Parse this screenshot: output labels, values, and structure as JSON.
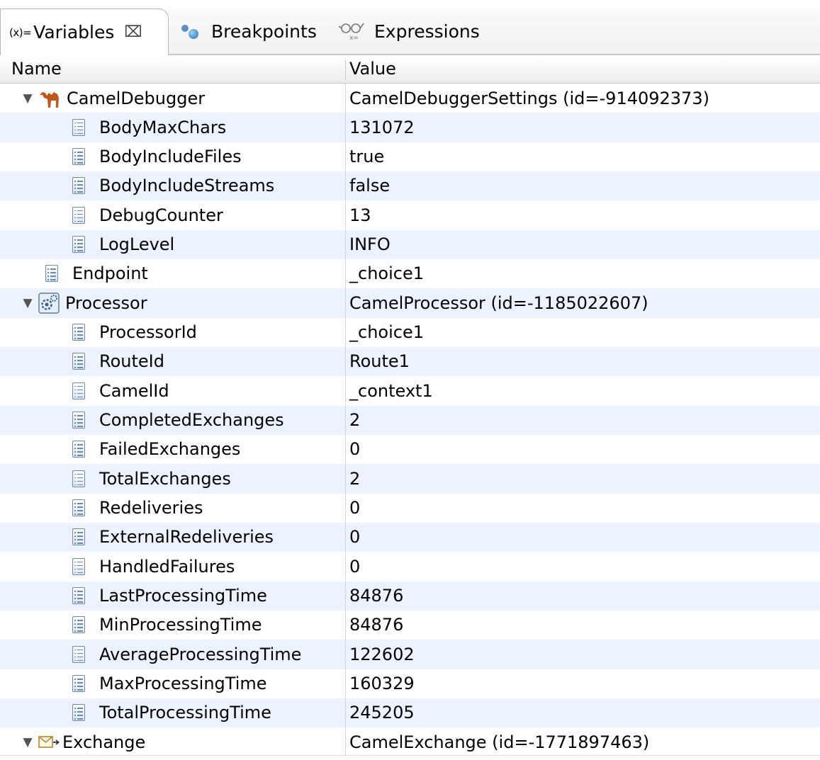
{
  "tabs": {
    "variables": {
      "symbol": "(x)=",
      "label": "Variables",
      "close": "⌧"
    },
    "breakpoints": {
      "label": "Breakpoints"
    },
    "expressions": {
      "label": "Expressions"
    }
  },
  "columns": {
    "name": "Name",
    "value": "Value"
  },
  "rows": [
    {
      "name": "CamelDebugger",
      "value": "CamelDebuggerSettings (id=-914092373)",
      "icon": "camel-icon",
      "expanded": true,
      "level": 0
    },
    {
      "name": "BodyMaxChars",
      "value": "131072",
      "icon": "field-icon",
      "level": 1
    },
    {
      "name": "BodyIncludeFiles",
      "value": "true",
      "icon": "field-icon",
      "level": 1
    },
    {
      "name": "BodyIncludeStreams",
      "value": "false",
      "icon": "field-icon",
      "level": 1
    },
    {
      "name": "DebugCounter",
      "value": "13",
      "icon": "field-icon",
      "level": 1
    },
    {
      "name": "LogLevel",
      "value": "INFO",
      "icon": "field-icon",
      "level": 1
    },
    {
      "name": "Endpoint",
      "value": "_choice1",
      "icon": "field-icon",
      "level": 0
    },
    {
      "name": "Processor",
      "value": "CamelProcessor (id=-1185022607)",
      "icon": "processor-icon",
      "expanded": true,
      "level": 0
    },
    {
      "name": "ProcessorId",
      "value": "_choice1",
      "icon": "field-icon",
      "level": 1
    },
    {
      "name": "RouteId",
      "value": "Route1",
      "icon": "field-icon",
      "level": 1
    },
    {
      "name": "CamelId",
      "value": "_context1",
      "icon": "field-icon",
      "level": 1
    },
    {
      "name": "CompletedExchanges",
      "value": "2",
      "icon": "field-icon",
      "level": 1
    },
    {
      "name": "FailedExchanges",
      "value": "0",
      "icon": "field-icon",
      "level": 1
    },
    {
      "name": "TotalExchanges",
      "value": "2",
      "icon": "field-icon",
      "level": 1
    },
    {
      "name": "Redeliveries",
      "value": "0",
      "icon": "field-icon",
      "level": 1
    },
    {
      "name": "ExternalRedeliveries",
      "value": "0",
      "icon": "field-icon",
      "level": 1
    },
    {
      "name": "HandledFailures",
      "value": "0",
      "icon": "field-icon",
      "level": 1
    },
    {
      "name": "LastProcessingTime",
      "value": "84876",
      "icon": "field-icon",
      "level": 1
    },
    {
      "name": "MinProcessingTime",
      "value": "84876",
      "icon": "field-icon",
      "level": 1
    },
    {
      "name": "AverageProcessingTime",
      "value": "122602",
      "icon": "field-icon",
      "level": 1
    },
    {
      "name": "MaxProcessingTime",
      "value": "160329",
      "icon": "field-icon",
      "level": 1
    },
    {
      "name": "TotalProcessingTime",
      "value": "245205",
      "icon": "field-icon",
      "level": 1
    },
    {
      "name": "Exchange",
      "value": "CamelExchange (id=-1771897463)",
      "icon": "exchange-icon",
      "expanded": true,
      "level": 0
    }
  ]
}
